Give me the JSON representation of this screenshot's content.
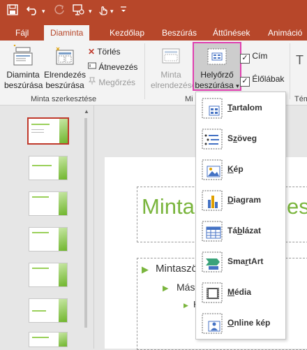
{
  "quick_access": {
    "save_icon": "save-icon",
    "undo_icon": "undo-icon",
    "redo_icon": "redo-icon",
    "present_icon": "present-icon",
    "touch_icon": "touch-mode-icon",
    "customize_icon": "customize-qat-icon"
  },
  "tabs": [
    {
      "label": "Fájl"
    },
    {
      "label": "Diaminta"
    },
    {
      "label": "Kezdőlap"
    },
    {
      "label": "Beszúrás"
    },
    {
      "label": "Áttűnések"
    },
    {
      "label": "Animáció"
    }
  ],
  "ribbon": {
    "insert_master": {
      "line1": "Diaminta",
      "line2": "beszúrása"
    },
    "insert_layout": {
      "line1": "Elrendezés",
      "line2": "beszúrása"
    },
    "delete": "Törlés",
    "rename": "Átnevezés",
    "preserve": "Megőrzés",
    "group_edit_master": "Minta szerkesztése",
    "master_layout": {
      "line1": "Minta",
      "line2": "elrendezése"
    },
    "insert_placeholder": {
      "line1": "Helyőrző",
      "line2": "beszúrása"
    },
    "title_check": "Cím",
    "footers_check": "Élőlábak",
    "group_layout_partial": "Mi",
    "group_theme_partial": "Tém"
  },
  "canvas": {
    "title_text": "Mintac",
    "title_tail": "esz",
    "bullet1": "Mintaszö",
    "bullet2": "Máso",
    "bullet3": "H"
  },
  "placeholder_menu": [
    {
      "label": "Tartalom",
      "accel": "T",
      "rest": "artalom",
      "icon": "content-placeholder-icon"
    },
    {
      "label": "Szöveg",
      "accel": "z",
      "pre": "S",
      "rest": "öveg",
      "icon": "text-placeholder-icon"
    },
    {
      "label": "Kép",
      "accel": "K",
      "rest": "ép",
      "icon": "picture-placeholder-icon"
    },
    {
      "label": "Diagram",
      "accel": "D",
      "rest": "iagram",
      "icon": "chart-placeholder-icon"
    },
    {
      "label": "Táblázat",
      "accel": "b",
      "pre": "Tá",
      "rest": "lázat",
      "icon": "table-placeholder-icon"
    },
    {
      "label": "SmartArt",
      "accel": "r",
      "pre": "Sma",
      "rest": "tArt",
      "icon": "smartart-placeholder-icon"
    },
    {
      "label": "Média",
      "accel": "M",
      "rest": "édia",
      "icon": "media-placeholder-icon"
    },
    {
      "label": "Online kép",
      "accel": "O",
      "rest": "nline kép",
      "icon": "online-picture-placeholder-icon"
    }
  ],
  "colors": {
    "accent": "#b7472a",
    "highlight_border": "#e040b0",
    "theme_green": "#7ab53d"
  }
}
